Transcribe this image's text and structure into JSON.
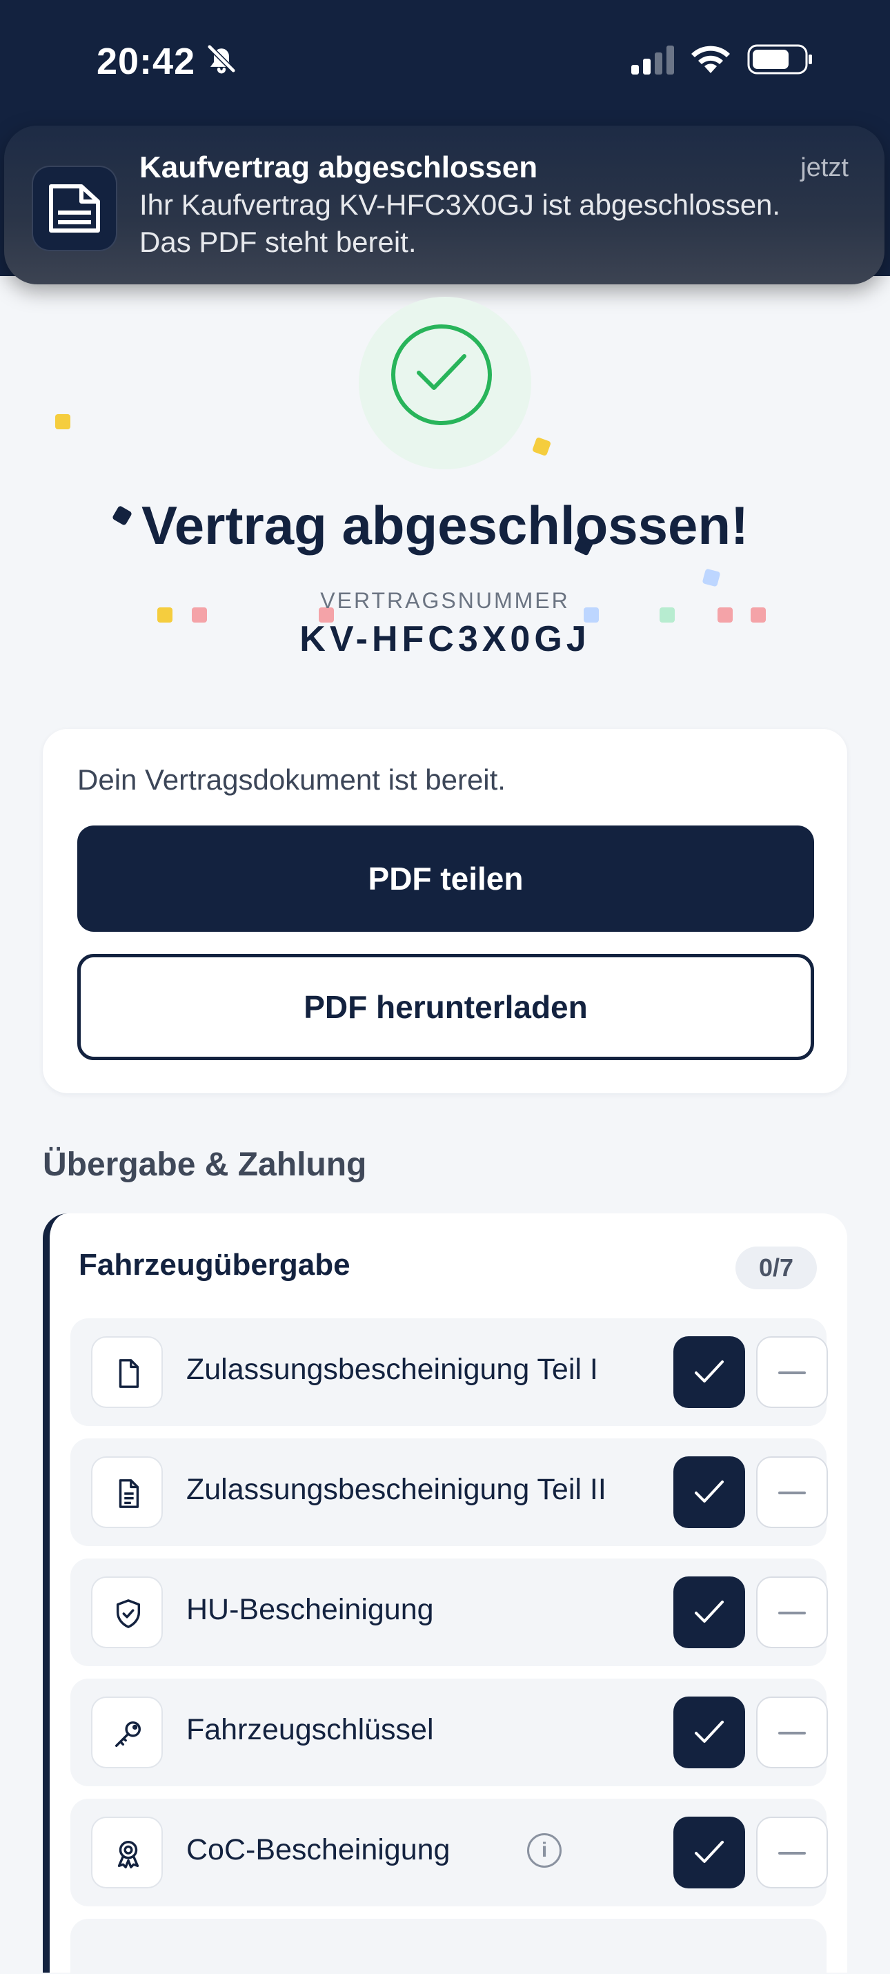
{
  "status_bar": {
    "time": "20:42",
    "icons": [
      "bell-slash-icon",
      "cellular-signal-icon",
      "wifi-icon",
      "battery-icon"
    ]
  },
  "notification": {
    "title": "Kaufvertrag abgeschlossen",
    "time": "jetzt",
    "body": "Ihr Kaufvertrag KV-HFC3X0GJ ist abgeschlossen. Das PDF steht bereit.",
    "icon": "document-icon"
  },
  "success": {
    "headline": "Vertrag abgeschlossen!",
    "contract_label": "VERTRAGSNUMMER",
    "contract_number": "KV-HFC3X0GJ",
    "icon": "checkmark-circle-icon"
  },
  "document_card": {
    "ready_text": "Dein Vertragsdokument ist bereit.",
    "share_label": "PDF teilen",
    "download_label": "PDF herunterladen"
  },
  "handover": {
    "section_title": "Übergabe & Zahlung",
    "group_title": "Fahrzeugübergabe",
    "count": "0/7",
    "items": [
      {
        "label": "Zulassungsbescheinigung Teil I",
        "icon": "file-icon"
      },
      {
        "label": "Zulassungsbescheinigung Teil II",
        "icon": "file-text-icon"
      },
      {
        "label": "HU-Bescheinigung",
        "icon": "shield-check-icon"
      },
      {
        "label": "Fahrzeugschlüssel",
        "icon": "key-icon"
      },
      {
        "label": "CoC-Bescheinigung",
        "icon": "award-icon",
        "info": "i"
      }
    ]
  },
  "colors": {
    "navy": "#13223f",
    "success_green": "#28b45a",
    "background": "#f4f6f9"
  }
}
